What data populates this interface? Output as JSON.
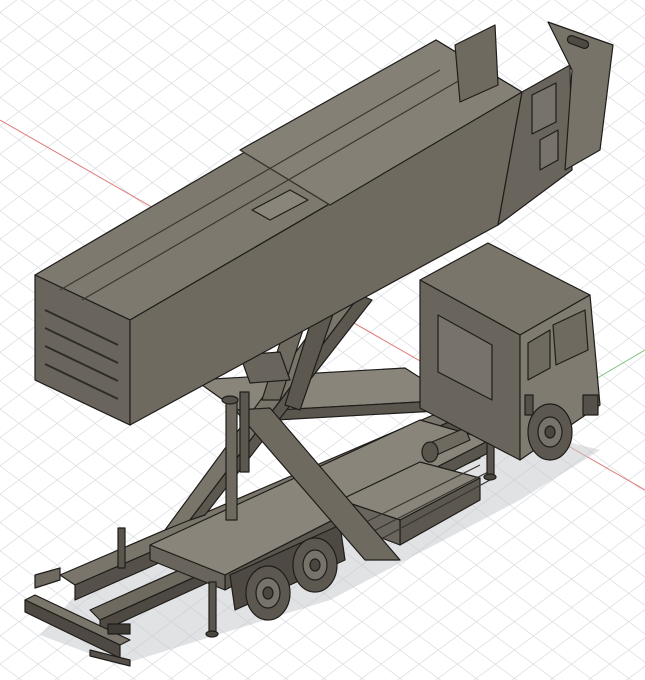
{
  "viewport": {
    "title": "",
    "background": "#ffffff",
    "grid_color": "#d8dbe0",
    "grid_major_color": "#c9cdd3",
    "axis_colors": {
      "x": "#e07a7a",
      "y": "#7fc77f"
    }
  },
  "model": {
    "name": "",
    "body_color": "#6f6a60",
    "body_light": "#8a857b",
    "body_dark": "#4e4a43",
    "edge_color": "#1f1d1a",
    "shadow_color": "#b9bcbf"
  }
}
